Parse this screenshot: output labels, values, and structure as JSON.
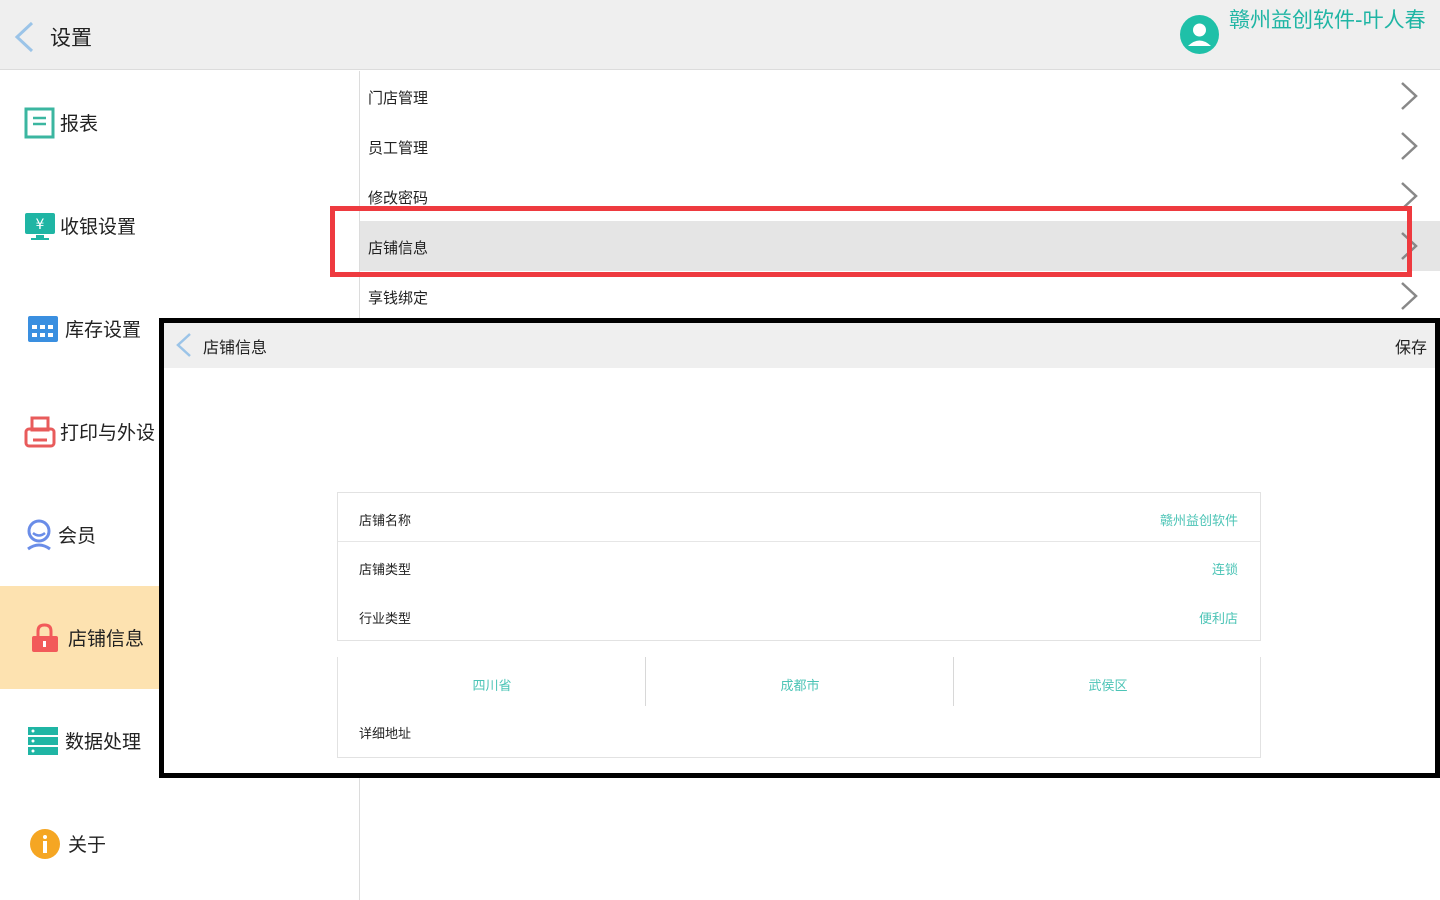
{
  "header": {
    "title": "设置",
    "user_name": "赣州益创软件-叶人春"
  },
  "sidebar": {
    "items": [
      {
        "label": "报表",
        "icon": "report-icon"
      },
      {
        "label": "收银设置",
        "icon": "cashier-monitor-icon"
      },
      {
        "label": "库存设置",
        "icon": "inventory-grid-icon"
      },
      {
        "label": "打印与外设",
        "icon": "printer-icon"
      },
      {
        "label": "会员",
        "icon": "member-icon"
      },
      {
        "label": "店铺信息",
        "icon": "lock-icon",
        "active": true
      },
      {
        "label": "数据处理",
        "icon": "server-icon"
      },
      {
        "label": "关于",
        "icon": "info-icon"
      }
    ]
  },
  "settings_list": {
    "items": [
      {
        "label": "门店管理"
      },
      {
        "label": "员工管理"
      },
      {
        "label": "修改密码"
      },
      {
        "label": "店铺信息",
        "highlighted": true
      },
      {
        "label": "享钱绑定"
      }
    ]
  },
  "store_panel": {
    "title": "店铺信息",
    "save_label": "保存",
    "fields": {
      "store_name": {
        "label": "店铺名称",
        "value": "赣州益创软件"
      },
      "store_type": {
        "label": "店铺类型",
        "value": "连锁"
      },
      "industry_type": {
        "label": "行业类型",
        "value": "便利店"
      }
    },
    "address": {
      "province": "四川省",
      "city": "成都市",
      "district": "武侯区",
      "detail_label": "详细地址"
    }
  },
  "colors": {
    "accent": "#1fb5a4",
    "active_sidebar": "#fde2b0",
    "highlight_row": "#e5e5e5",
    "annotation_red": "#ee3a3f",
    "annotation_black": "#000000"
  }
}
